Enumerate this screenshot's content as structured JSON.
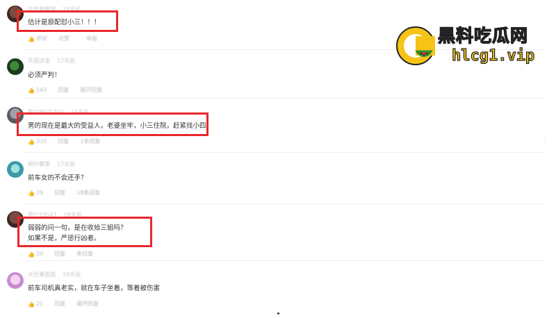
{
  "comments": [
    {
      "username": "灰色蜘蛛网",
      "time": "18天前",
      "text": [
        "估计是原配怼小三！！！"
      ],
      "likes": "评论",
      "reply": "点赞",
      "more": "⋯举报"
    },
    {
      "username": "灰雨凉宝",
      "time": "17天前",
      "text": [
        "必须严判！"
      ],
      "likes": "143",
      "reply": "回复",
      "more": "展开回复"
    },
    {
      "username": "用户8675333",
      "time": "16天前",
      "text": [
        "男的现在是最大的受益人，老婆坐牢，小三住院，赶紧找小四"
      ],
      "likes": "310",
      "reply": "回复",
      "more": "1条回复"
    },
    {
      "username": "枫叶飘零",
      "time": "17天前",
      "text": [
        "前车女的不会还手？"
      ],
      "likes": "29",
      "reply": "回复",
      "more": "18条回复"
    },
    {
      "username": "用户23547",
      "time": "18天前",
      "text": [
        "弱弱的问一句，是在收拾三姐吗？",
        "如果不是，严惩行凶者。"
      ],
      "likes": "20",
      "reply": "回复",
      "more": "条回复"
    },
    {
      "username": "大芒果很甜",
      "time": "18天前",
      "text": [
        "前车司机真老实，就在车子坐着，等着被伤害"
      ],
      "likes": "21",
      "reply": "回复",
      "more": "展开回复"
    }
  ],
  "watermark": {
    "title": "黑料吃瓜网",
    "url": "hlcg1.vip"
  },
  "colors": {
    "highlight": "#e8282b",
    "logo_yellow": "#f5c416"
  }
}
